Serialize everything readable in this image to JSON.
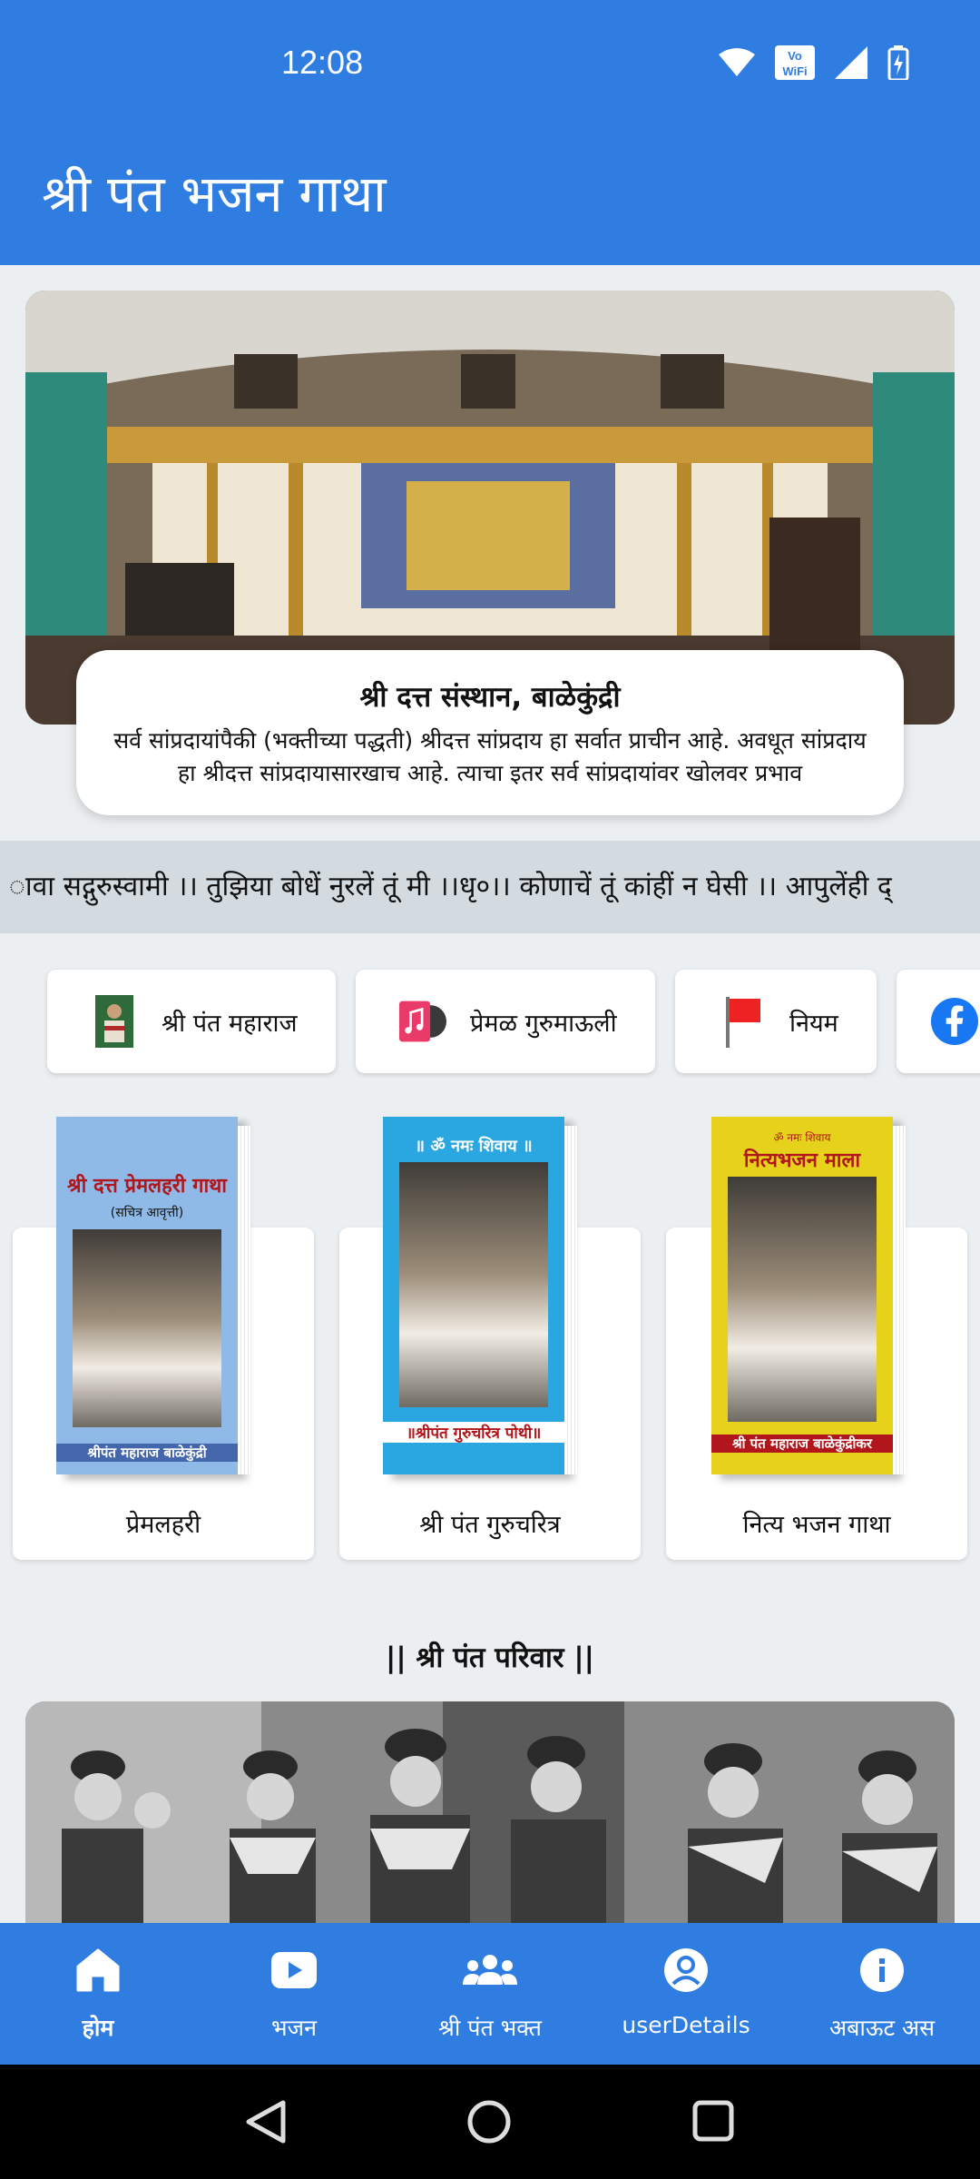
{
  "status_bar": {
    "time": "12:08",
    "icons": [
      "wifi-icon",
      "vowifi-icon",
      "signal-icon",
      "battery-charging-icon"
    ]
  },
  "app_bar": {
    "title": "श्री पंत भजन गाथा"
  },
  "hero": {
    "title": "श्री दत्त संस्थान, बाळेकुंद्री",
    "description": "सर्व सांप्रदायांपैकी (भक्तीच्या पद्धती) श्रीदत्त सांप्रदाय हा सर्वात प्राचीन आहे. अवधूत सांप्रदाय हा श्रीदत्त सांप्रदायासारखाच आहे. त्याचा इतर सर्व सांप्रदायांवर खोलवर प्रभाव"
  },
  "ticker": {
    "text": "ावा सद्गुरुस्वामी ।। तुझिया बोधें नुरलें तूं मी ।।धृ०।। कोणाचें तूं कांहीं न घेसी ।। आपुलेंही द्"
  },
  "quick_links": [
    {
      "label": "श्री पंत महाराज",
      "icon": "portrait-icon"
    },
    {
      "label": "प्रेमळ गुरुमाऊली",
      "icon": "music-album-icon"
    },
    {
      "label": "नियम",
      "icon": "red-flag-icon"
    },
    {
      "label": "",
      "icon": "facebook-icon"
    }
  ],
  "books": [
    {
      "label": "प्रेमलहरी",
      "cover_title": "श्री दत्त प्रेमलहरी गाथा",
      "cover_subtitle": "(सचित्र आवृत्ती)",
      "cover_footer": "श्रीपंत महाराज बाळेकुंद्री",
      "cover_color": "#8fb9e6"
    },
    {
      "label": "श्री पंत गुरुचरित्र",
      "cover_title": "॥ ॐ नमः शिवाय ॥",
      "cover_subtitle": "",
      "cover_footer": "॥श्रीपंत गुरुचरित्र पोथी॥",
      "cover_color": "#2aa6e0"
    },
    {
      "label": "नित्य भजन गाथा",
      "cover_title": "नित्यभजन माला",
      "cover_subtitle": "ॐ नमः शिवाय",
      "cover_footer": "श्री पंत महाराज बाळेकुंद्रीकर",
      "cover_color": "#e6d21a"
    }
  ],
  "family_section": {
    "title": "|| श्री पंत परिवार ||"
  },
  "bottom_nav": [
    {
      "label": "होम",
      "icon": "home-icon",
      "active": true
    },
    {
      "label": "भजन",
      "icon": "video-play-icon",
      "active": false
    },
    {
      "label": "श्री पंत भक्त",
      "icon": "group-icon",
      "active": false
    },
    {
      "label": "userDetails",
      "icon": "account-circle-icon",
      "active": false
    },
    {
      "label": "अबाऊट अस",
      "icon": "info-icon",
      "active": false
    }
  ],
  "colors": {
    "primary": "#2f7de1",
    "background": "#eceff1",
    "ticker_bg": "#d3dbe0"
  }
}
